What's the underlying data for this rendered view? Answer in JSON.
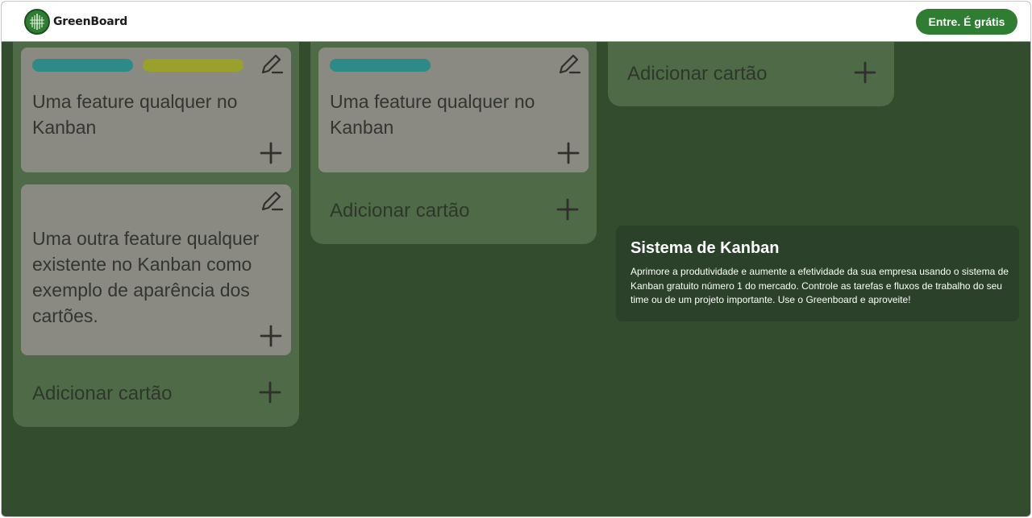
{
  "header": {
    "brand": "GreenBoard",
    "cta_label": "Entre. É grátis"
  },
  "columns": [
    {
      "cards": [
        {
          "text": "Uma feature qualquer no Kanban",
          "tags": [
            "teal",
            "yellow"
          ]
        },
        {
          "text": "Uma outra feature qualquer existente no Kanban como exemplo de aparência dos cartões.",
          "tags": []
        }
      ],
      "add_label": "Adicionar cartão"
    },
    {
      "cards": [
        {
          "text": "Uma feature qualquer no Kanban",
          "tags": [
            "teal"
          ]
        }
      ],
      "add_label": "Adicionar cartão"
    },
    {
      "cards": [],
      "add_label": "Adicionar cartão"
    }
  ],
  "info": {
    "title": "Sistema de Kanban",
    "text": "Aprimore a produtividade e aumente a efetividade da sua empresa usando o sistema de Kanban gratuito número 1 do mercado. Controle as tarefas e fluxos de trabalho do seu time ou de um projeto importante. Use o Greenboard e aproveite!"
  },
  "colors": {
    "brand_green": "#2e7d32",
    "board_background": "#334c2d",
    "column_background": "#4f6a46",
    "card_background": "#8a8a82",
    "tag_teal": "#2e8a86",
    "tag_yellow": "#9aa02c",
    "info_panel": "#2c412a"
  },
  "icons": {
    "edit": "pencil-icon",
    "add": "plus-icon",
    "logo": "tree-logo-icon"
  }
}
